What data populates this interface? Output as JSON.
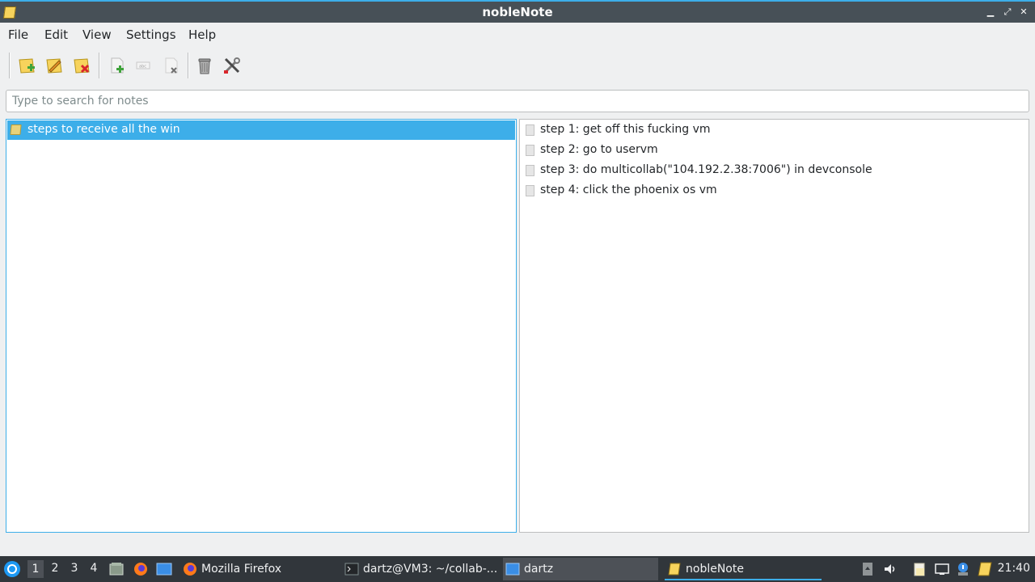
{
  "window": {
    "title": "nobleNote",
    "minimize_label": "▁",
    "maximize_label": "⤢",
    "close_label": "✕"
  },
  "menubar": {
    "items": [
      "File",
      "Edit",
      "View",
      "Settings",
      "Help"
    ]
  },
  "toolbar": {
    "buttons": [
      "new-folder-icon",
      "rename-folder-icon",
      "delete-folder-icon",
      "new-note-icon",
      "rename-note-icon",
      "delete-note-icon",
      "trash-icon",
      "preferences-icon"
    ]
  },
  "search": {
    "placeholder": "Type to search for notes",
    "value": ""
  },
  "folders": [
    {
      "label": "steps to receive all the win",
      "selected": true
    }
  ],
  "notes": [
    {
      "label": "step 1: get off this fucking vm"
    },
    {
      "label": "step 2: go to uservm"
    },
    {
      "label": "step 3: do multicollab(\"104.192.2.38:7006\") in devconsole"
    },
    {
      "label": "step 4: click the phoenix os vm"
    }
  ],
  "taskbar": {
    "workspaces": [
      "1",
      "2",
      "3",
      "4"
    ],
    "active_workspace": "1",
    "tasks": [
      {
        "label": "Mozilla Firefox"
      },
      {
        "label": "dartz@VM3: ~/collab-..."
      },
      {
        "label": "dartz"
      },
      {
        "label": "nobleNote"
      }
    ],
    "clock": "21:40"
  },
  "colors": {
    "accent": "#3daee9",
    "titlebar": "#475057",
    "taskbar": "#31363b",
    "note_icon": "#f7d35c"
  }
}
